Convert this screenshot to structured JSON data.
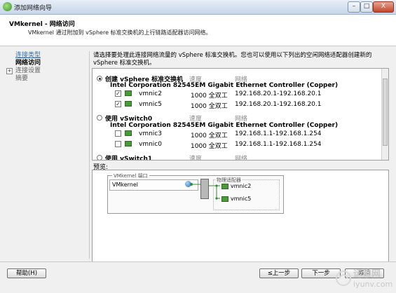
{
  "window": {
    "title": "添加网络向导",
    "buttons": [
      "–",
      "□",
      "X"
    ]
  },
  "header": {
    "title": "VMkernel - 网络访问",
    "subtitle": "VMkernel 通过附加到 vSphere 标准交换机的上行链路适配器访问网络。"
  },
  "nav": {
    "items": [
      "连接类型",
      "网络访问",
      "连接设置",
      "摘要"
    ]
  },
  "description": "请选择要处理此连接网络流量的 vSphere 标准交换机。您也可以使用以下列出的空闲网络适配器创建新的 vSphere 标准交换机。",
  "switch_options": [
    {
      "label": "创建 vSphere 标准交换机",
      "selected": true,
      "col_speed": "速度",
      "col_network": "网络",
      "adapter": "Intel Corporation 82545EM Gigabit Ethernet Controller (Copper)",
      "nics": [
        {
          "name": "vmnic2",
          "checked": true,
          "speed": "1000 全双工",
          "network": "192.168.20.1-192.168.20.1"
        },
        {
          "name": "vmnic5",
          "checked": true,
          "speed": "1000 全双工",
          "network": "192.168.20.1-192.168.20.1"
        }
      ]
    },
    {
      "label": "使用 vSwitch0",
      "selected": false,
      "col_speed": "速度",
      "col_network": "网络",
      "adapter": "Intel Corporation 82545EM Gigabit Ethernet Controller (Copper)",
      "nics": [
        {
          "name": "vmnic3",
          "checked": false,
          "speed": "1000 全双工",
          "network": "192.168.1.1-192.168.1.254"
        },
        {
          "name": "vmnic0",
          "checked": false,
          "speed": "1000 全双工",
          "network": "192.168.1.1-192.168.1.254"
        }
      ]
    },
    {
      "label": "使用 vSwitch1",
      "selected": false,
      "col_speed": "速度",
      "col_network": "网络"
    }
  ],
  "preview": {
    "label": "预览:",
    "port_group": "VMkernel 端口",
    "port_name": "VMkernel",
    "adapters_group": "物理适配器",
    "adapters": [
      "vmnic2",
      "vmnic5"
    ]
  },
  "buttons": {
    "help": "帮助(H)",
    "back": "≤上一步",
    "next": "下一步",
    "cancel": "取消"
  },
  "watermark": {
    "line1": "运维网",
    "line2": "iyunv.com"
  }
}
